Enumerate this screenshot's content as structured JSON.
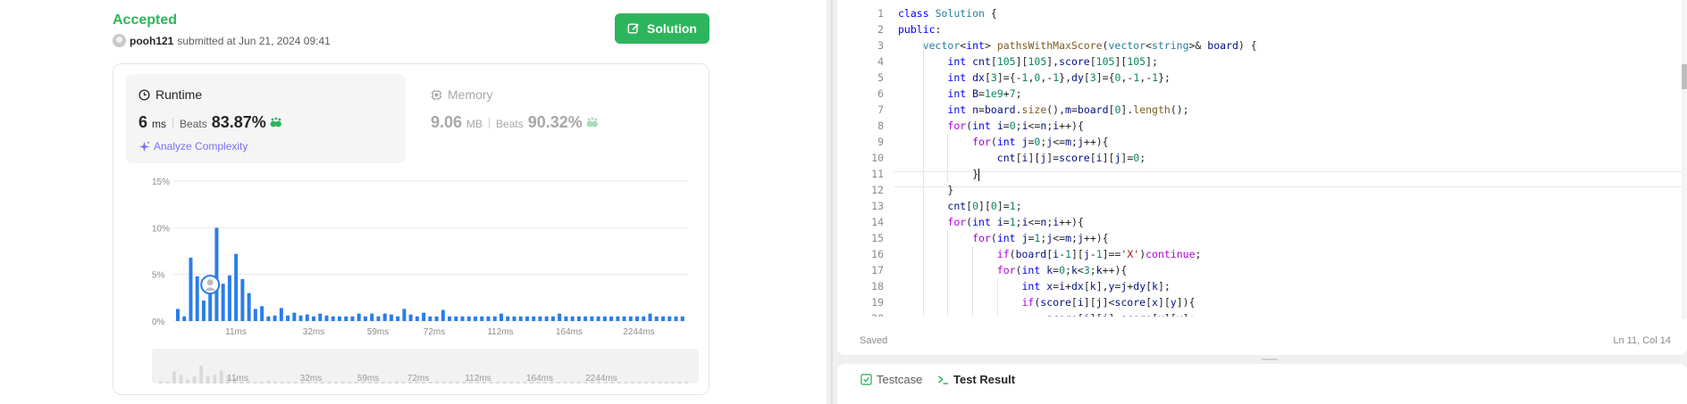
{
  "submission": {
    "status": "Accepted",
    "username": "pooh121",
    "submitted_text": "submitted at Jun 21, 2024 09:41",
    "solution_button": "Solution"
  },
  "runtime": {
    "title": "Runtime",
    "value": "6",
    "unit": "ms",
    "beats_label": "Beats",
    "beats_value": "83.87%",
    "analyze_label": "Analyze Complexity"
  },
  "memory": {
    "title": "Memory",
    "value": "9.06",
    "unit": "MB",
    "beats_label": "Beats",
    "beats_value": "90.32%"
  },
  "colors": {
    "accepted": "#2db55d",
    "bar": "#2b7de9",
    "analyze": "#7c6ff0"
  },
  "chart_data": {
    "type": "bar",
    "ylim": [
      0,
      15
    ],
    "y_ticks": [
      "15%",
      "10%",
      "5%",
      "0%"
    ],
    "x_tick_labels": [
      "11ms",
      "32ms",
      "59ms",
      "72ms",
      "112ms",
      "164ms",
      "2244ms"
    ],
    "values": [
      1.3,
      0.5,
      6.8,
      4.8,
      2.2,
      4.0,
      10.0,
      4.0,
      4.9,
      7.2,
      4.5,
      3.0,
      1.3,
      1.6,
      0.5,
      0.6,
      1.4,
      0.6,
      0.9,
      0.6,
      0.7,
      0.5,
      0.8,
      0.6,
      0.5,
      0.5,
      0.5,
      0.5,
      0.8,
      0.5,
      0.8,
      0.5,
      0.8,
      0.7,
      0.5,
      1.3,
      0.7,
      0.5,
      0.9,
      0.5,
      0.5,
      1.2,
      0.5,
      0.5,
      0.5,
      0.5,
      0.5,
      0.5,
      0.5,
      0.5,
      0.8,
      0.5,
      0.5,
      0.5,
      0.5,
      0.5,
      0.5,
      0.5,
      0.5,
      0.8,
      0.5,
      0.5,
      0.5,
      0.5,
      0.5,
      0.5,
      0.5,
      0.5,
      0.5,
      0.5,
      0.5,
      0.5,
      0.5,
      0.8,
      0.5,
      0.5,
      0.5,
      0.5,
      0.5
    ],
    "marker_bin_index": 5,
    "grid": true
  },
  "editor": {
    "lines": [
      "class Solution {",
      "public:",
      "    vector<int> pathsWithMaxScore(vector<string>& board) {",
      "        int cnt[105][105],score[105][105];",
      "        int dx[3]={-1,0,-1},dy[3]={0,-1,-1};",
      "        int B=1e9+7;",
      "        int n=board.size(),m=board[0].length();",
      "        for(int i=0;i<=n;i++){",
      "            for(int j=0;j<=m;j++){",
      "                cnt[i][j]=score[i][j]=0;",
      "            }",
      "        }",
      "        cnt[0][0]=1;",
      "        for(int i=1;i<=n;i++){",
      "            for(int j=1;j<=m;j++){",
      "                if(board[i-1][j-1]=='X')continue;",
      "                for(int k=0;k<3;k++){",
      "                    int x=i+dx[k],y=j+dy[k];",
      "                    if(score[i][j]<score[x][y]){",
      "                        score[i][j]=score[x][y];"
    ],
    "line_numbers": [
      "1",
      "2",
      "3",
      "4",
      "5",
      "6",
      "7",
      "8",
      "9",
      "10",
      "11",
      "12",
      "13",
      "14",
      "15",
      "16",
      "17",
      "18",
      "19",
      "20"
    ],
    "active_line": 11,
    "saved_label": "Saved",
    "cursor_position": "Ln 11, Col 14"
  },
  "bottom_tabs": {
    "testcase": "Testcase",
    "test_result": "Test Result"
  }
}
